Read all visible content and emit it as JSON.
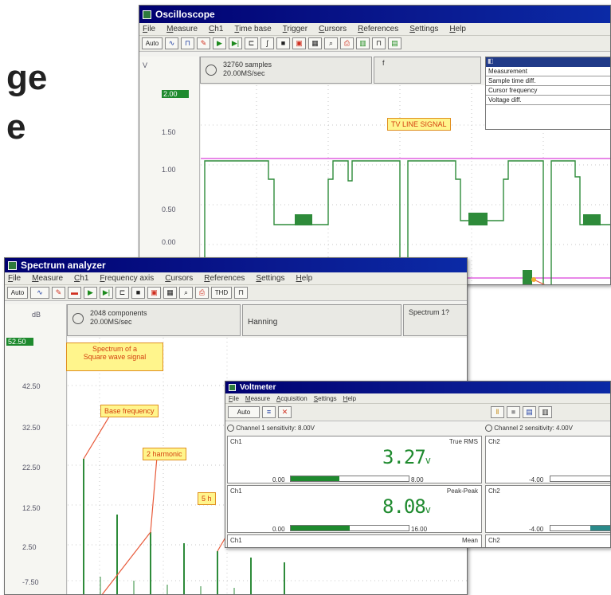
{
  "background_text": {
    "line1": "ge",
    "line2": "e"
  },
  "oscilloscope": {
    "title": "Oscilloscope",
    "menu": [
      "File",
      "Measure",
      "Ch1",
      "Time base",
      "Trigger",
      "Cursors",
      "References",
      "Settings",
      "Help"
    ],
    "toolbar_auto": "Auto",
    "samples": "32760 samples",
    "rate": "20.00MS/sec",
    "trigger_marker": "f",
    "y_unit": "V",
    "y_labels": [
      "2.00",
      "1.50",
      "1.00",
      "0.50",
      "0.00"
    ],
    "annotation": "TV LINE SIGNAL",
    "measure_table": {
      "header": "Measurement",
      "rows": [
        "Measurement",
        "Sample time diff.",
        "Cursor frequency",
        "Voltage diff."
      ]
    },
    "signal_color": "#2e8b3a",
    "reference_color": "#e060e0"
  },
  "spectrum": {
    "title": "Spectrum analyzer",
    "menu": [
      "File",
      "Measure",
      "Ch1",
      "Frequency axis",
      "Cursors",
      "References",
      "Settings",
      "Help"
    ],
    "toolbar_auto": "Auto",
    "thd_label": "THD",
    "components": "2048 components",
    "rate": "20.00MS/sec",
    "window": "Hanning",
    "right_info": "Spectrum 1?",
    "y_unit": "dB",
    "y_labels": [
      "52.50",
      "42.50",
      "32.50",
      "22.50",
      "12.50",
      "2.50",
      "-7.50"
    ],
    "notes": {
      "main": "Spectrum of a\nSquare wave signal",
      "base": "Base frequency",
      "h2": "2 harmonic",
      "h3": "5 h"
    }
  },
  "voltmeter": {
    "title": "Voltmeter",
    "menu": [
      "File",
      "Measure",
      "Acquisition",
      "Settings",
      "Help"
    ],
    "auto": "Auto",
    "ch1_sensitivity": "Channel 1 sensitivity: 8.00V",
    "ch2_sensitivity": "Channel 2 sensitivity: 4.00V",
    "panels": [
      {
        "ch": "Ch1",
        "mode": "True RMS",
        "value": "3.27",
        "unit": "v",
        "min": "0.00",
        "max": "8.00",
        "level": 0.41
      },
      {
        "ch": "Ch1",
        "mode": "Peak-Peak",
        "value": "8.08",
        "unit": "v",
        "min": "0.00",
        "max": "16.00",
        "level": 0.5
      },
      {
        "ch": "Ch1",
        "mode": "Mean"
      }
    ],
    "ch2_panels": [
      {
        "ch": "Ch2",
        "min": "-4.00"
      },
      {
        "ch": "Ch2",
        "min": "-4.00"
      },
      {
        "ch": "Ch2"
      }
    ]
  }
}
